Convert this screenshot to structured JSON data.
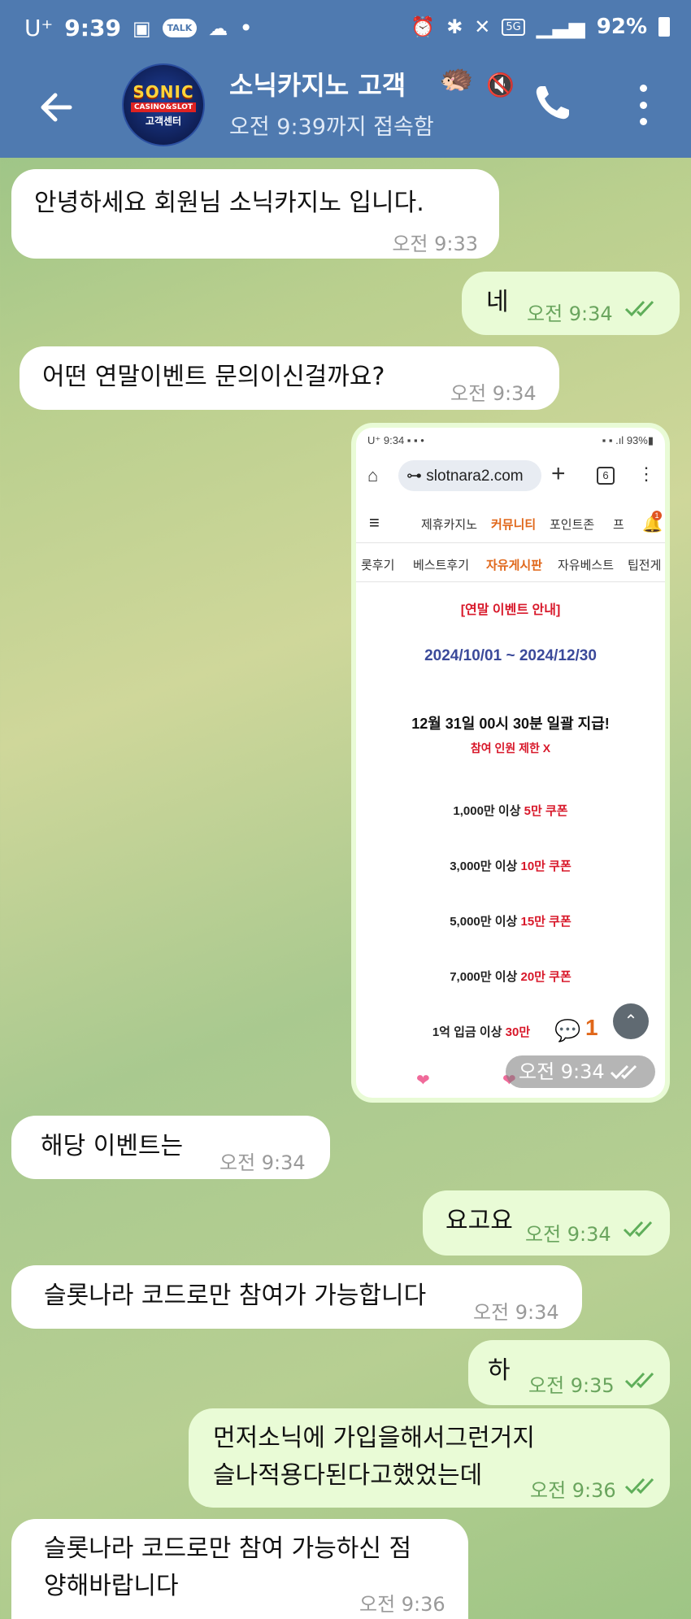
{
  "status_bar": {
    "carrier": "U⁺",
    "time": "9:39",
    "network": "5G",
    "battery": "92%"
  },
  "header": {
    "back_icon": "back-arrow-icon",
    "avatar": {
      "line1": "SONIC",
      "line2": "CASINO&SLOT",
      "line3": "고객센터"
    },
    "title": "소닉카지노 고객",
    "subtitle": "오전 9:39까지 접속함",
    "call_icon": "phone-icon",
    "more_icon": "more-vertical-icon"
  },
  "messages": [
    {
      "dir": "in",
      "text": "안녕하세요 회원님 소닉카지노 입니다.",
      "time": "오전 9:33"
    },
    {
      "dir": "out",
      "text": "네",
      "time": "오전 9:34"
    },
    {
      "dir": "in",
      "text": "어떤 연말이벤트 문의이신걸까요?",
      "time": "오전 9:34"
    },
    {
      "dir": "in",
      "text": "해당 이벤트는",
      "time": "오전 9:34"
    },
    {
      "dir": "out",
      "text": "요고요",
      "time": "오전 9:34"
    },
    {
      "dir": "in",
      "text": "슬롯나라 코드로만 참여가 가능합니다",
      "time": "오전 9:34"
    },
    {
      "dir": "out",
      "text": "하",
      "time": "오전 9:35"
    },
    {
      "dir": "out",
      "lines": [
        "먼저소닉에 가입을해서그런거지",
        "슬나적용다된다고했었는데"
      ],
      "time": "오전 9:36"
    },
    {
      "dir": "in",
      "lines": [
        "슬롯나라 코드로만 참여 가능하신 점",
        "양해바랍니다"
      ],
      "time": "오전 9:36"
    }
  ],
  "image_message": {
    "time": "오전 9:34",
    "screenshot": {
      "status_time": "9:34",
      "status_battery": "93%",
      "url": "slotnara2.com",
      "tab_count": "6",
      "nav1": [
        "제휴카지노",
        "커뮤니티",
        "포인트존",
        "프"
      ],
      "bell_badge": "1",
      "nav2": [
        "롯후기",
        "베스트후기",
        "자유게시판",
        "자유베스트",
        "팁전게"
      ],
      "notice_title": "[연말 이벤트 안내]",
      "period": "2024/10/01 ~ 2024/12/30",
      "pay_time": "12월 31일 00시 30분 일괄 지급!",
      "limit": "참여 인원 제한 X",
      "tiers": [
        {
          "cond": "1,000만 이상",
          "reward": "5만 쿠폰"
        },
        {
          "cond": "3,000만 이상",
          "reward": "10만 쿠폰"
        },
        {
          "cond": "5,000만 이상",
          "reward": "15만 쿠폰"
        },
        {
          "cond": "7,000만 이상",
          "reward": "20만 쿠폰"
        },
        {
          "cond": "1억 입금 이상",
          "reward": "30만"
        }
      ],
      "comment_count": "1"
    }
  },
  "colors": {
    "header_bg": "#4f7ab0",
    "incoming_bubble": "#ffffff",
    "outgoing_bubble": "#e9fbd6",
    "check_green": "#5fae5a",
    "accent_orange": "#e0671a",
    "accent_red": "#d8182a"
  }
}
